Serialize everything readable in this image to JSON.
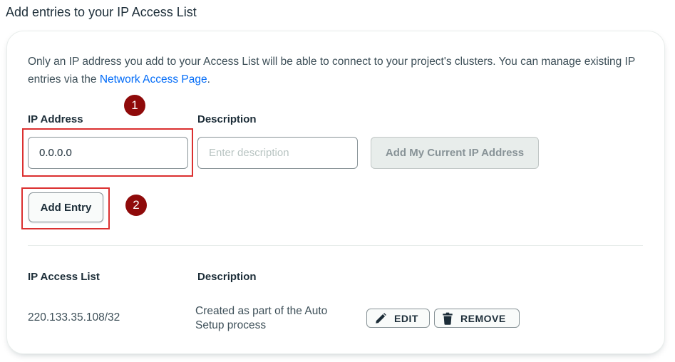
{
  "page": {
    "title": "Add entries to your IP Access List"
  },
  "intro": {
    "text": "Only an IP address you add to your Access List will be able to connect to your project's clusters. You can manage existing IP entries via the ",
    "link_label": "Network Access Page",
    "suffix": "."
  },
  "form": {
    "ip_label": "IP Address",
    "ip_value": "0.0.0.0",
    "description_label": "Description",
    "description_placeholder": "Enter description",
    "add_current_ip_label": "Add My Current IP Address",
    "add_entry_label": "Add Entry"
  },
  "annotations": {
    "step1": "1",
    "step2": "2",
    "highlight_color": "#db3030",
    "badge_color": "#8f0a0a"
  },
  "access_list": {
    "headers": [
      "IP Access List",
      "Description"
    ],
    "rows": [
      {
        "ip": "220.133.35.108/32",
        "description": "Created as part of the Auto Setup process",
        "edit_label": "EDIT",
        "remove_label": "REMOVE"
      }
    ]
  },
  "icons": {
    "edit": "pencil-icon",
    "remove": "trash-icon"
  },
  "colors": {
    "link": "#016bf8",
    "text": "#1c2d38"
  }
}
